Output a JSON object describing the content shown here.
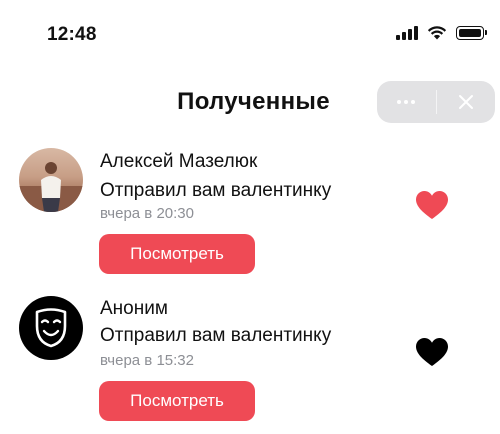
{
  "status_bar": {
    "time": "12:48",
    "icons": [
      "cellular-signal-icon",
      "wifi-icon",
      "battery-icon"
    ]
  },
  "header": {
    "title": "Полученные",
    "capsule": {
      "more_icon": "ellipsis-icon",
      "close_icon": "close-icon"
    }
  },
  "items": [
    {
      "avatar": "user-photo-avatar",
      "name": "Алексей Мазелюк",
      "subtitle": "Отправил вам валентинку",
      "time": "вчера в 20:30",
      "button": "Посмотреть",
      "heart_color": "#ef4a55"
    },
    {
      "avatar": "anonymous-mask-avatar",
      "name": "Аноним",
      "subtitle": "Отправил вам валентинку",
      "time": "вчера в 15:32",
      "button": "Посмотреть",
      "heart_color": "#000000"
    }
  ],
  "colors": {
    "accent": "#ef4a55",
    "secondary_text": "#8d8f95",
    "capsule_bg": "#e2e2e4"
  }
}
